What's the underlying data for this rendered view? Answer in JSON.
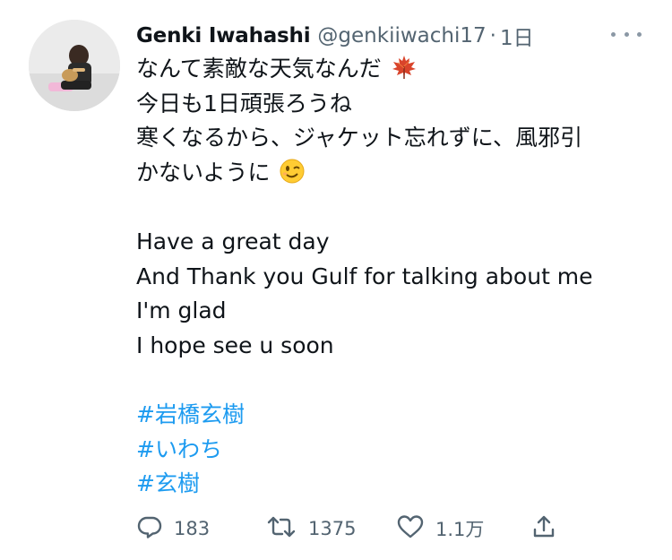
{
  "tweet": {
    "author_name": "Genki Iwahashi",
    "handle": "@genkiiwachi17",
    "separator": "·",
    "time": "1日",
    "lines_ja": [
      "なんて素敵な天気なんだ",
      "今日も1日頑張ろうね",
      "寒くなるから、ジャケット忘れずに、風邪引",
      "かないように"
    ],
    "lines_en": [
      "Have a great day",
      "And Thank you Gulf for talking about me",
      "I'm glad",
      "I hope see u soon"
    ],
    "hashtags": [
      "#岩橋玄樹",
      "#いわち",
      "#玄樹"
    ],
    "emoji": [
      "maple-leaf-emoji",
      "winking-face-emoji"
    ]
  },
  "actions": {
    "reply_count": "183",
    "retweet_count": "1375",
    "like_count": "1.1万"
  },
  "colors": {
    "link": "#1d9bf0",
    "secondary_text": "#536471",
    "primary_text": "#0f1419"
  }
}
